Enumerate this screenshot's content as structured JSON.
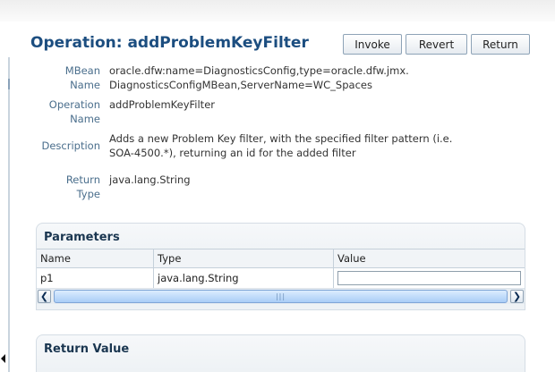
{
  "operation": {
    "title": "Operation: addProblemKeyFilter",
    "buttons": {
      "invoke": "Invoke",
      "revert": "Revert",
      "return": "Return"
    }
  },
  "details": {
    "mbean_label_line1": "MBean",
    "mbean_label_line2": "Name",
    "mbean_value_line1": "oracle.dfw:name=DiagnosticsConfig,type=oracle.dfw.jmx.",
    "mbean_value_line2": "DiagnosticsConfigMBean,ServerName=WC_Spaces",
    "operation_label_line1": "Operation",
    "operation_label_line2": "Name",
    "operation_value": "addProblemKeyFilter",
    "description_label": "Description",
    "description_value_line1": "Adds a new Problem Key filter, with the specified filter pattern (i.e.",
    "description_value_line2": "SOA-4500.*), returning an id for the added filter",
    "return_type_label_line1": "Return",
    "return_type_label_line2": "Type",
    "return_type_value": "java.lang.String"
  },
  "parameters": {
    "title": "Parameters",
    "columns": [
      "Name",
      "Type",
      "Value"
    ],
    "rows": [
      {
        "name": "p1",
        "type": "java.lang.String",
        "value": ""
      }
    ]
  },
  "return_value": {
    "title": "Return Value"
  }
}
